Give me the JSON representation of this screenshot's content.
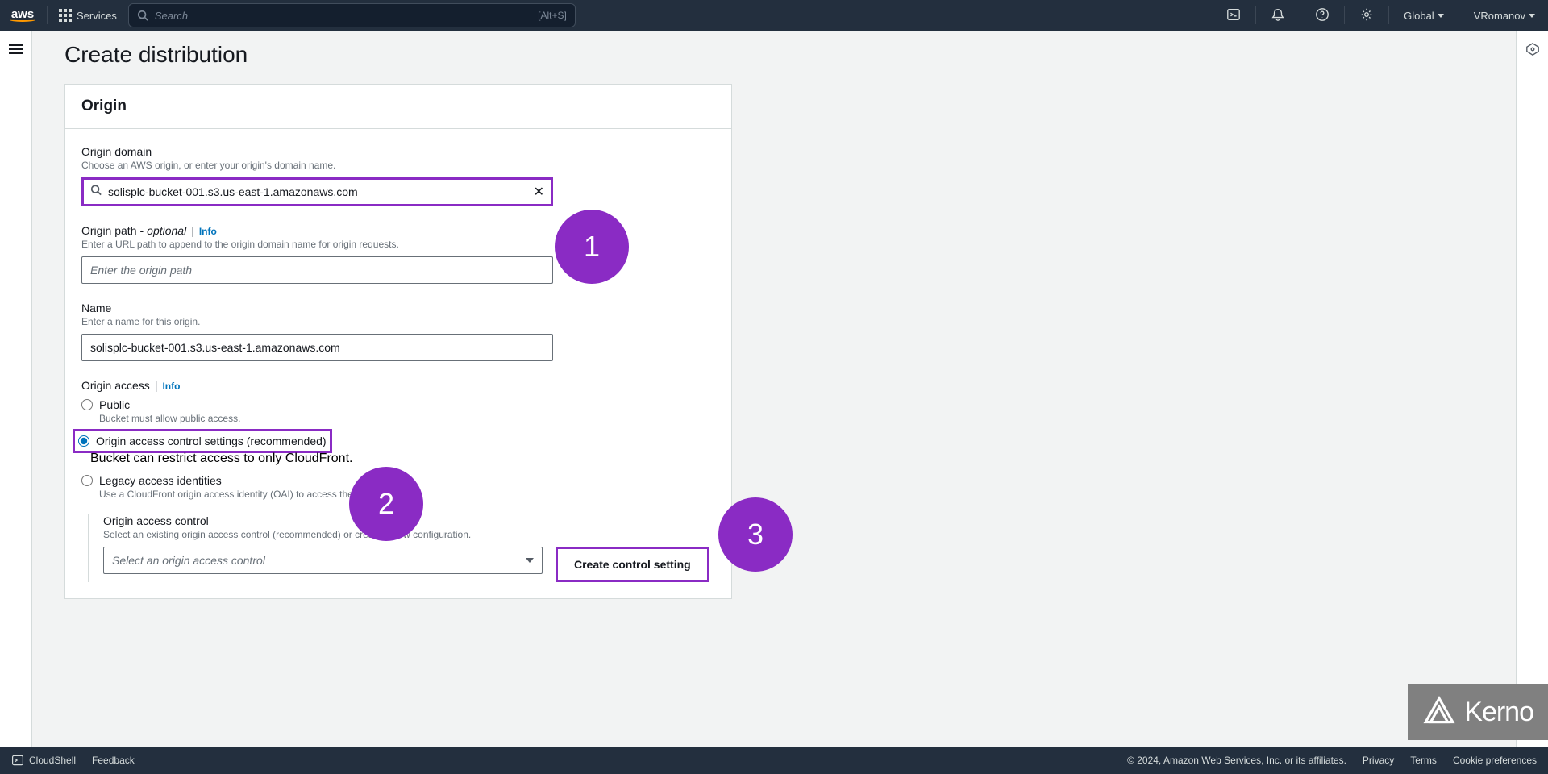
{
  "nav": {
    "services_label": "Services",
    "search_placeholder": "Search",
    "search_shortcut": "[Alt+S]",
    "region": "Global",
    "username": "VRomanov"
  },
  "page": {
    "title": "Create distribution"
  },
  "panel": {
    "heading": "Origin"
  },
  "origin_domain": {
    "label": "Origin domain",
    "hint": "Choose an AWS origin, or enter your origin's domain name.",
    "value": "solisplc-bucket-001.s3.us-east-1.amazonaws.com"
  },
  "origin_path": {
    "label": "Origin path",
    "optional": "optional",
    "info": "Info",
    "hint": "Enter a URL path to append to the origin domain name for origin requests.",
    "placeholder": "Enter the origin path"
  },
  "origin_name": {
    "label": "Name",
    "hint": "Enter a name for this origin.",
    "value": "solisplc-bucket-001.s3.us-east-1.amazonaws.com"
  },
  "origin_access": {
    "label": "Origin access",
    "info": "Info",
    "options": {
      "public": {
        "label": "Public",
        "hint": "Bucket must allow public access."
      },
      "oac": {
        "label": "Origin access control settings (recommended)",
        "hint": "Bucket can restrict access to only CloudFront."
      },
      "legacy": {
        "label": "Legacy access identities",
        "hint": "Use a CloudFront origin access identity (OAI) to access the S3 bucket."
      }
    }
  },
  "oac_section": {
    "label": "Origin access control",
    "hint": "Select an existing origin access control (recommended) or create a new configuration.",
    "select_placeholder": "Select an origin access control",
    "create_button": "Create control setting"
  },
  "annotations": {
    "one": "1",
    "two": "2",
    "three": "3"
  },
  "footer": {
    "cloudshell": "CloudShell",
    "feedback": "Feedback",
    "copyright": "© 2024, Amazon Web Services, Inc. or its affiliates.",
    "privacy": "Privacy",
    "terms": "Terms",
    "cookies": "Cookie preferences"
  },
  "watermark": "Kerno"
}
